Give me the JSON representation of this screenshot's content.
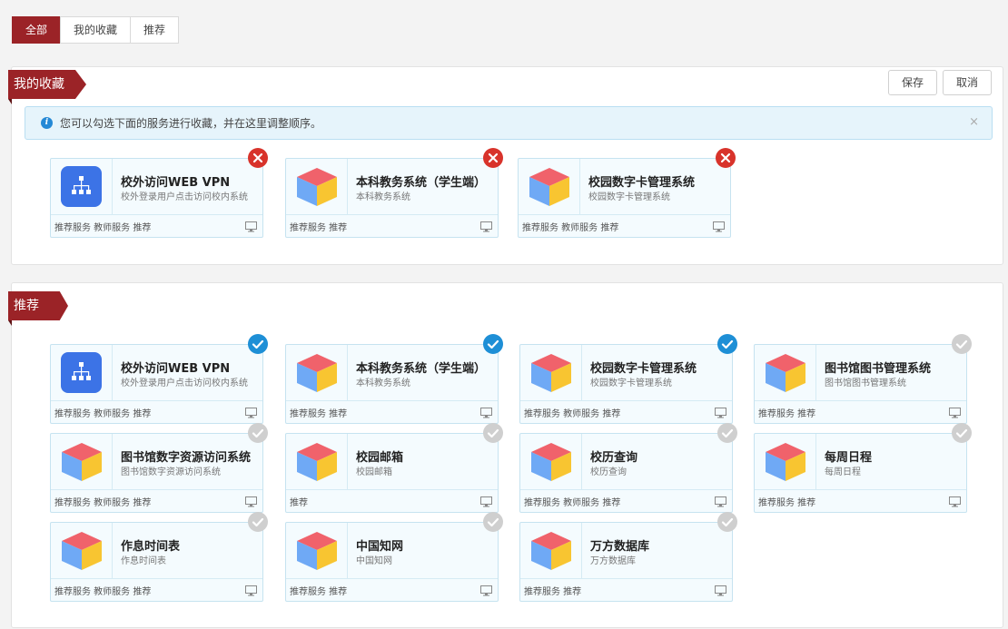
{
  "tabs": [
    {
      "label": "全部",
      "active": true
    },
    {
      "label": "我的收藏",
      "active": false
    },
    {
      "label": "推荐",
      "active": false
    }
  ],
  "favorites": {
    "heading": "我的收藏",
    "save_label": "保存",
    "cancel_label": "取消",
    "alert_text": "您可以勾选下面的服务进行收藏，并在这里调整顺序。",
    "alert_close": "×",
    "cards": [
      {
        "title": "校外访问WEB VPN",
        "desc": "校外登录用户点击访问校内系统",
        "tags": "推荐服务 教师服务 推荐",
        "icon": "network-icon"
      },
      {
        "title": "本科教务系统（学生端）",
        "desc": "本科教务系统",
        "tags": "推荐服务 推荐",
        "icon": "cube-icon"
      },
      {
        "title": "校园数字卡管理系统",
        "desc": "校园数字卡管理系统",
        "tags": "推荐服务 教师服务 推荐",
        "icon": "cube-icon"
      }
    ]
  },
  "recommend": {
    "heading": "推荐",
    "cards": [
      {
        "title": "校外访问WEB VPN",
        "desc": "校外登录用户点击访问校内系统",
        "tags": "推荐服务 教师服务 推荐",
        "icon": "network-icon",
        "checked": true
      },
      {
        "title": "本科教务系统（学生端）",
        "desc": "本科教务系统",
        "tags": "推荐服务 推荐",
        "icon": "cube-icon",
        "checked": true
      },
      {
        "title": "校园数字卡管理系统",
        "desc": "校园数字卡管理系统",
        "tags": "推荐服务 教师服务 推荐",
        "icon": "cube-icon",
        "checked": true
      },
      {
        "title": "图书馆图书管理系统",
        "desc": "图书馆图书管理系统",
        "tags": "推荐服务 推荐",
        "icon": "cube-icon",
        "checked": false
      },
      {
        "title": "图书馆数字资源访问系统",
        "desc": "图书馆数字资源访问系统",
        "tags": "推荐服务 教师服务 推荐",
        "icon": "cube-icon",
        "checked": false
      },
      {
        "title": "校园邮箱",
        "desc": "校园邮箱",
        "tags": "推荐",
        "icon": "cube-icon",
        "checked": false
      },
      {
        "title": "校历查询",
        "desc": "校历查询",
        "tags": "推荐服务 教师服务 推荐",
        "icon": "cube-icon",
        "checked": false
      },
      {
        "title": "每周日程",
        "desc": "每周日程",
        "tags": "推荐服务 推荐",
        "icon": "cube-icon",
        "checked": false
      },
      {
        "title": "作息时间表",
        "desc": "作息时间表",
        "tags": "推荐服务 教师服务 推荐",
        "icon": "cube-icon",
        "checked": false
      },
      {
        "title": "中国知网",
        "desc": "中国知网",
        "tags": "推荐服务 推荐",
        "icon": "cube-icon",
        "checked": false
      },
      {
        "title": "万方数据库",
        "desc": "万方数据库",
        "tags": "推荐服务 推荐",
        "icon": "cube-icon",
        "checked": false
      }
    ]
  },
  "colors": {
    "brand": "#9b2327",
    "card_bg": "#f4fbfe",
    "card_border": "#c6e3f0",
    "remove": "#d8332b",
    "checked": "#1e8fd6",
    "unchecked": "#cfcfcf",
    "vpn_blue": "#3c73e6"
  }
}
